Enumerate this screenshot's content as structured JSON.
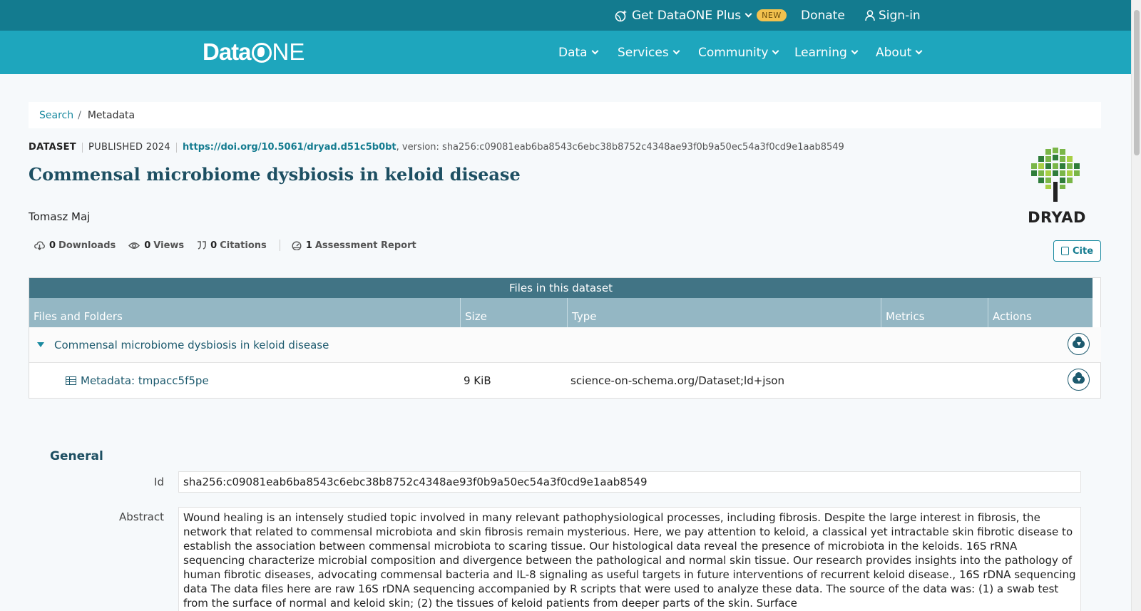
{
  "topbar": {
    "plus_label": "Get DataONE Plus",
    "new_badge": "NEW",
    "donate_label": "Donate",
    "signin_label": "Sign-in"
  },
  "logo": {
    "text_data": "Data",
    "text_one": "NE"
  },
  "nav": {
    "items": [
      {
        "label": "Data"
      },
      {
        "label": "Services"
      },
      {
        "label": "Community"
      },
      {
        "label": "Learning"
      },
      {
        "label": "About"
      }
    ]
  },
  "breadcrumb": {
    "search": "Search",
    "separator": "/",
    "current": "Metadata"
  },
  "dataset": {
    "type": "DATASET",
    "published": "PUBLISHED 2024",
    "doi": "https://doi.org/10.5061/dryad.d51c5b0bt",
    "version": ", version: sha256:c09081eab6ba8543c6ebc38b8752c4348ae93f0b9a50ec54a3f0cd9e1aab8549",
    "title": "Commensal microbiome dysbiosis in keloid disease",
    "author": "Tomasz Maj",
    "repository_logo_text": "DRYAD"
  },
  "metrics": {
    "downloads_count": "0",
    "downloads_label": "Downloads",
    "views_count": "0",
    "views_label": "Views",
    "citations_count": "0",
    "citations_label": "Citations",
    "assessment_count": "1",
    "assessment_label": "Assessment Report",
    "cite_label": "Cite"
  },
  "files": {
    "heading": "Files in this dataset",
    "columns": [
      "Files and Folders",
      "Size",
      "Type",
      "Metrics",
      "Actions"
    ],
    "folder": {
      "name": "Commensal microbiome dysbiosis in keloid disease"
    },
    "rows": [
      {
        "name": "Metadata: tmpacc5f5pe",
        "size": "9 KiB",
        "type": "science-on-schema.org/Dataset;ld+json"
      }
    ]
  },
  "general": {
    "heading": "General",
    "id_label": "Id",
    "id_value": "sha256:c09081eab6ba8543c6ebc38b8752c4348ae93f0b9a50ec54a3f0cd9e1aab8549",
    "abstract_label": "Abstract",
    "abstract_value": "Wound healing is an intensely studied topic involved in many relevant pathophysiological processes, including fibrosis. Despite the large interest in fibrosis, the network that related to commensal microbiota and skin fibrosis remain mysterious. Here, we pay attention to keloid, a classical yet intractable skin fibrotic disease to establish the association between commensal microbiota to scaring tissue. Our histological data reveal the presence of microbiota in the keloids. 16S rRNA sequencing characterize microbial composition and divergence between the pathological and normal skin tissue. Our research provides insights into the pathology of human fibrotic diseases, advocating commensal bacteria and IL-8 signaling as useful targets in future interventions of recurrent keloid disease., 16S rDNA sequencing data The data files here are raw 16S rDNA sequencing accompanied by R scripts that were used to analyze these data. The source of the data was: (1) a swab test from the surface of normal and keloid skin; (2) the tissues of keloid patients from deeper parts of the skin. Surface"
  },
  "colors": {
    "topbar": "#137b8f",
    "navbar": "#1ea6bd",
    "accent": "#1a8aa0",
    "title": "#1d4f62",
    "table_head": "#417485",
    "table_cols": "#94b7c4",
    "badge": "#f2c14e"
  },
  "icons": [
    "globe-sparkle-icon",
    "user-icon",
    "chevron-down-icon",
    "cloud-download-icon",
    "eye-icon",
    "quote-icon",
    "gauge-icon",
    "copy-icon",
    "table-icon",
    "caret-down-icon",
    "dryad-tree-logo"
  ]
}
